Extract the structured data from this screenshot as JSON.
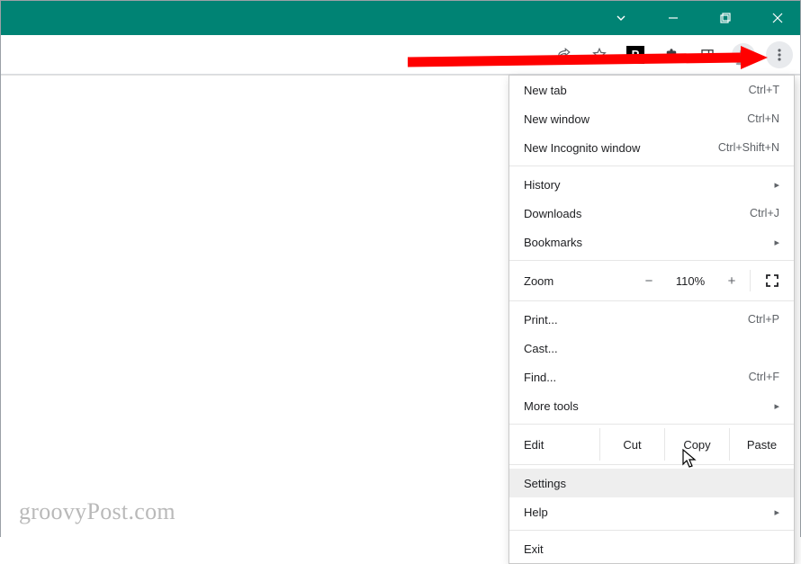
{
  "window": {
    "dropdown_hint": "v"
  },
  "toolbar": {
    "ext_label": "P"
  },
  "menu": {
    "new_tab": {
      "label": "New tab",
      "shortcut": "Ctrl+T"
    },
    "new_window": {
      "label": "New window",
      "shortcut": "Ctrl+N"
    },
    "new_incognito": {
      "label": "New Incognito window",
      "shortcut": "Ctrl+Shift+N"
    },
    "history": {
      "label": "History"
    },
    "downloads": {
      "label": "Downloads",
      "shortcut": "Ctrl+J"
    },
    "bookmarks": {
      "label": "Bookmarks"
    },
    "zoom": {
      "label": "Zoom",
      "percent": "110%"
    },
    "print": {
      "label": "Print...",
      "shortcut": "Ctrl+P"
    },
    "cast": {
      "label": "Cast..."
    },
    "find": {
      "label": "Find...",
      "shortcut": "Ctrl+F"
    },
    "more_tools": {
      "label": "More tools"
    },
    "edit": {
      "label": "Edit",
      "cut": "Cut",
      "copy": "Copy",
      "paste": "Paste"
    },
    "settings": {
      "label": "Settings"
    },
    "help": {
      "label": "Help"
    },
    "exit": {
      "label": "Exit"
    }
  },
  "watermark": "groovyPost.com"
}
